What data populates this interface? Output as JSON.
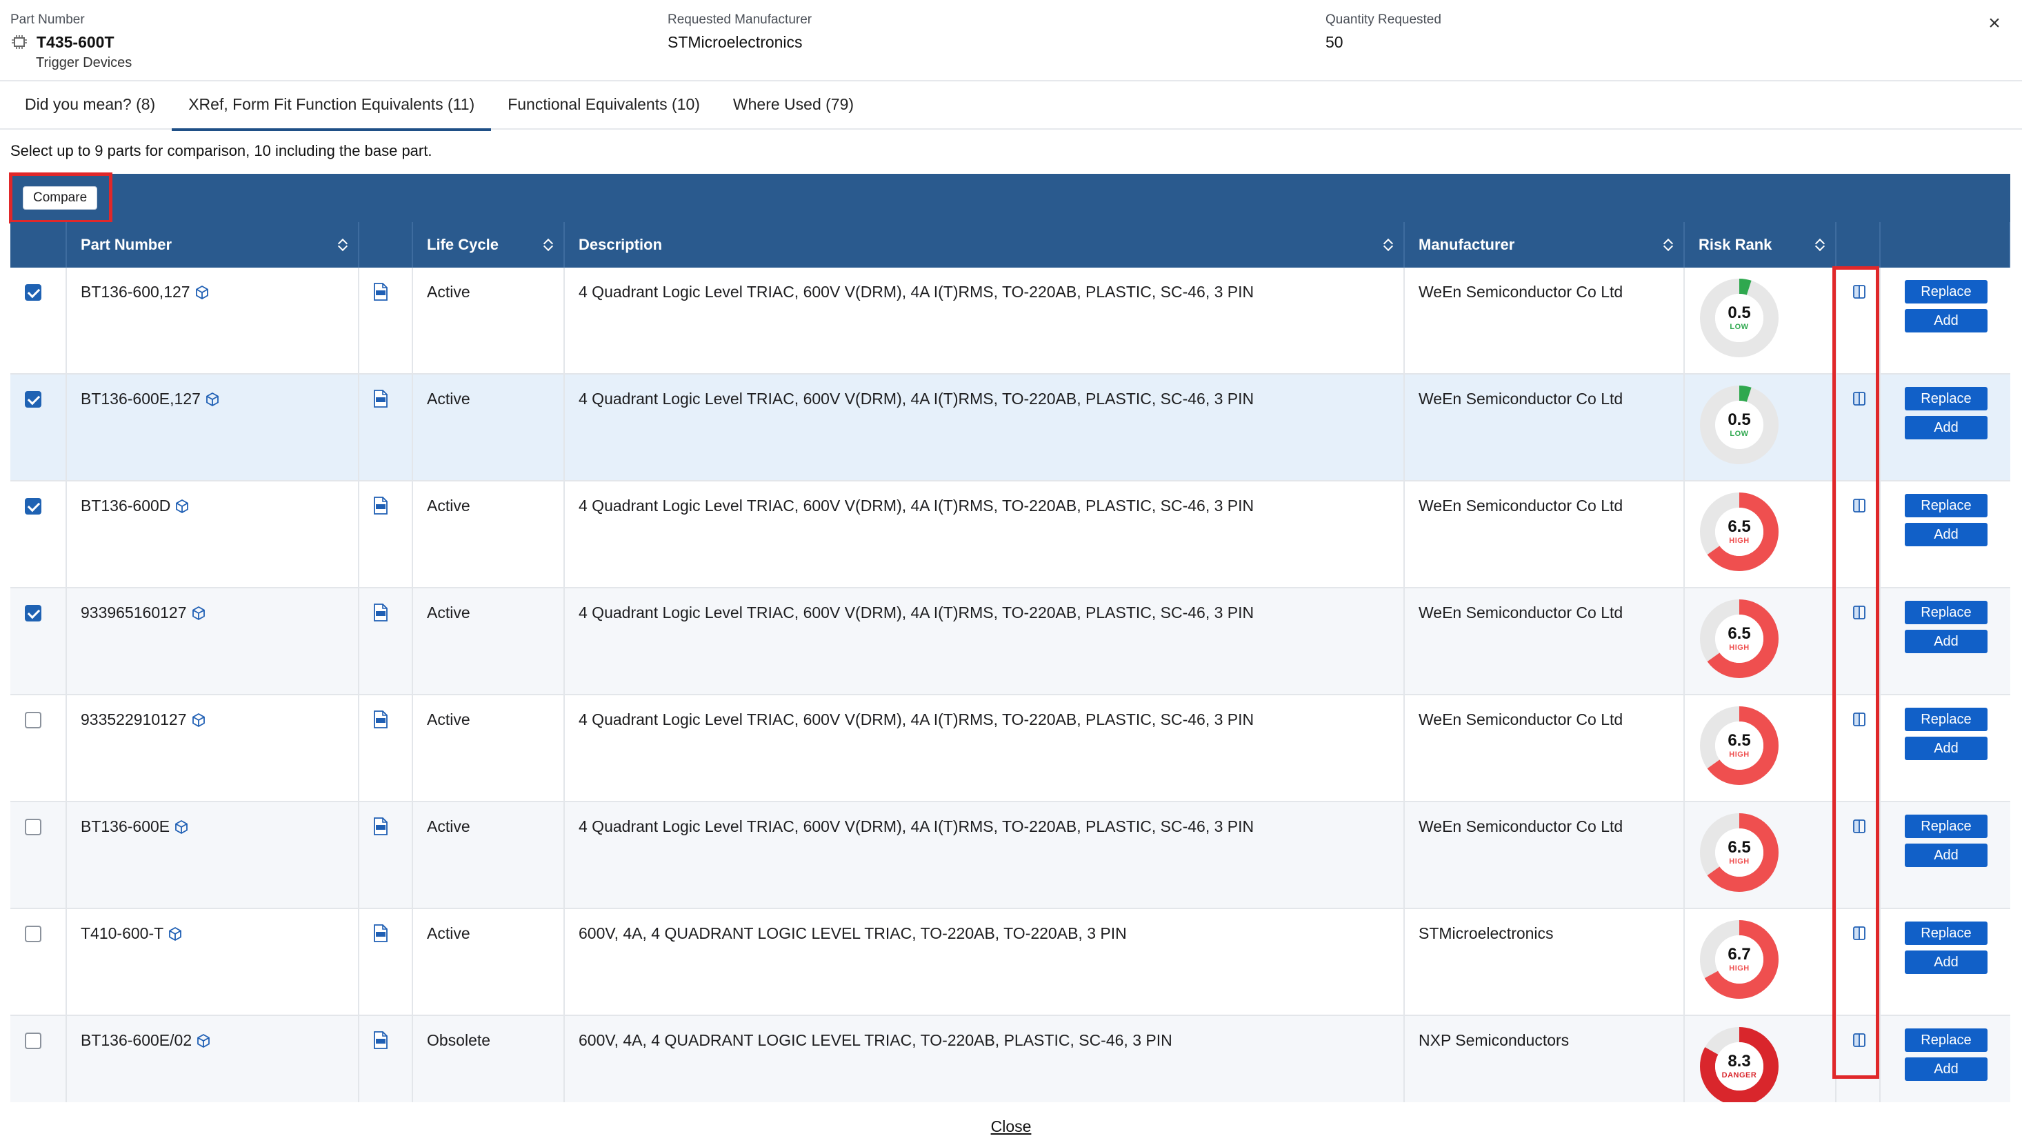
{
  "header": {
    "part_number_label": "Part Number",
    "part_number": "T435-600T",
    "category": "Trigger Devices",
    "requested_mfr_label": "Requested Manufacturer",
    "requested_mfr": "STMicroelectronics",
    "quantity_label": "Quantity Requested",
    "quantity": "50",
    "close_glyph": "×"
  },
  "tabs": [
    {
      "label": "Did you mean? (8)"
    },
    {
      "label": "XRef, Form Fit Function Equivalents (11)",
      "active": true
    },
    {
      "label": "Functional Equivalents (10)"
    },
    {
      "label": "Where Used (79)"
    }
  ],
  "instruction": "Select up to 9 parts for comparison, 10 including the base part.",
  "toolbar": {
    "compare_label": "Compare"
  },
  "columns": {
    "part_number": "Part Number",
    "life_cycle": "Life Cycle",
    "description": "Description",
    "manufacturer": "Manufacturer",
    "risk_rank": "Risk Rank"
  },
  "actions": {
    "replace": "Replace",
    "add": "Add"
  },
  "rows": [
    {
      "checked": true,
      "part": "BT136-600,127",
      "life_cycle": "Active",
      "description": "4 Quadrant Logic Level TRIAC, 600V V(DRM), 4A I(T)RMS, TO-220AB, PLASTIC, SC-46, 3 PIN",
      "manufacturer": "WeEn Semiconductor Co Ltd",
      "risk": "0.5",
      "risk_level": "LOW",
      "risk_fraction": 0.05
    },
    {
      "checked": true,
      "part": "BT136-600E,127",
      "life_cycle": "Active",
      "description": "4 Quadrant Logic Level TRIAC, 600V V(DRM), 4A I(T)RMS, TO-220AB, PLASTIC, SC-46, 3 PIN",
      "manufacturer": "WeEn Semiconductor Co Ltd",
      "risk": "0.5",
      "risk_level": "LOW",
      "risk_fraction": 0.05
    },
    {
      "checked": true,
      "part": "BT136-600D",
      "life_cycle": "Active",
      "description": "4 Quadrant Logic Level TRIAC, 600V V(DRM), 4A I(T)RMS, TO-220AB, PLASTIC, SC-46, 3 PIN",
      "manufacturer": "WeEn Semiconductor Co Ltd",
      "risk": "6.5",
      "risk_level": "HIGH",
      "risk_fraction": 0.65
    },
    {
      "checked": true,
      "part": "933965160127",
      "life_cycle": "Active",
      "description": "4 Quadrant Logic Level TRIAC, 600V V(DRM), 4A I(T)RMS, TO-220AB, PLASTIC, SC-46, 3 PIN",
      "manufacturer": "WeEn Semiconductor Co Ltd",
      "risk": "6.5",
      "risk_level": "HIGH",
      "risk_fraction": 0.65
    },
    {
      "checked": false,
      "part": "933522910127",
      "life_cycle": "Active",
      "description": "4 Quadrant Logic Level TRIAC, 600V V(DRM), 4A I(T)RMS, TO-220AB, PLASTIC, SC-46, 3 PIN",
      "manufacturer": "WeEn Semiconductor Co Ltd",
      "risk": "6.5",
      "risk_level": "HIGH",
      "risk_fraction": 0.65
    },
    {
      "checked": false,
      "part": "BT136-600E",
      "life_cycle": "Active",
      "description": "4 Quadrant Logic Level TRIAC, 600V V(DRM), 4A I(T)RMS, TO-220AB, PLASTIC, SC-46, 3 PIN",
      "manufacturer": "WeEn Semiconductor Co Ltd",
      "risk": "6.5",
      "risk_level": "HIGH",
      "risk_fraction": 0.65
    },
    {
      "checked": false,
      "part": "T410-600-T",
      "life_cycle": "Active",
      "description": "600V, 4A, 4 QUADRANT LOGIC LEVEL TRIAC, TO-220AB, TO-220AB, 3 PIN",
      "manufacturer": "STMicroelectronics",
      "risk": "6.7",
      "risk_level": "HIGH",
      "risk_fraction": 0.67
    },
    {
      "checked": false,
      "part": "BT136-600E/02",
      "life_cycle": "Obsolete",
      "description": "600V, 4A, 4 QUADRANT LOGIC LEVEL TRIAC, TO-220AB, PLASTIC, SC-46, 3 PIN",
      "manufacturer": "NXP Semiconductors",
      "risk": "8.3",
      "risk_level": "DANGER",
      "risk_fraction": 0.83
    }
  ],
  "colors": {
    "header_bg": "#2a5a8e",
    "button_blue": "#1160c8",
    "low": "#2fa84f",
    "high": "#ef4f4f",
    "danger": "#d9262c",
    "highlight_box": "#e0282a"
  },
  "footer": {
    "close_label": "Close"
  }
}
